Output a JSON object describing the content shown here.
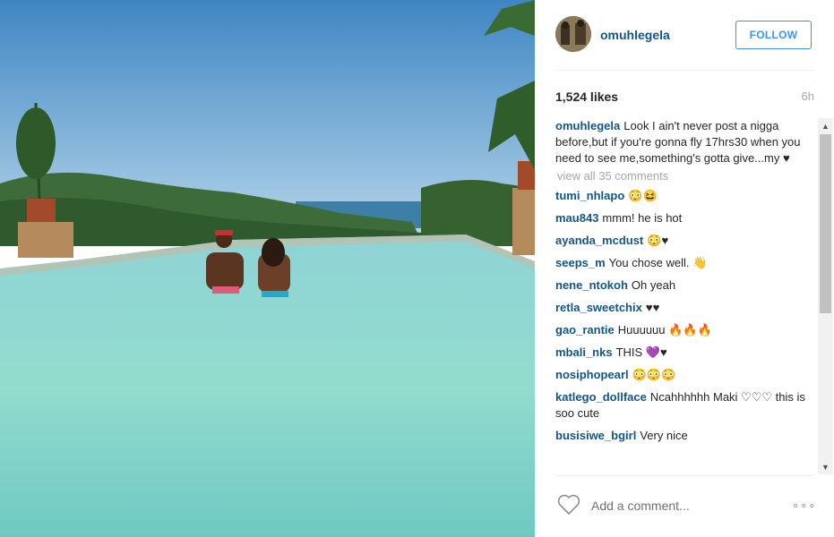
{
  "post": {
    "username": "omuhlegela",
    "follow_label": "FOLLOW",
    "likes": "1,524 likes",
    "time": "6h",
    "caption": {
      "user": "omuhlegela",
      "text": "Look I ain't never post a nigga before,but if you're gonna fly 17hrs30 when you need to see me,something's gotta give...my ♥"
    },
    "view_all": "view all 35 comments",
    "comments": [
      {
        "user": "tumi_nhlapo",
        "text": "😳😆"
      },
      {
        "user": "mau843",
        "text": "mmm! he is hot"
      },
      {
        "user": "ayanda_mcdust",
        "text": "😳♥"
      },
      {
        "user": "seeps_m",
        "text": "You chose well. 👋"
      },
      {
        "user": "nene_ntokoh",
        "text": "Oh yeah"
      },
      {
        "user": "retla_sweetchix",
        "text": "♥♥"
      },
      {
        "user": "gao_rantie",
        "text": "Huuuuuu 🔥🔥🔥"
      },
      {
        "user": "mbali_nks",
        "text": "THIS 💜♥"
      },
      {
        "user": "nosiphopearl",
        "text": "😳😳😳"
      },
      {
        "user": "katlego_dollface",
        "text": "Ncahhhhhh Maki ♡♡♡ this is soo cute"
      },
      {
        "user": "busisiwe_bgirl",
        "text": "Very nice"
      }
    ],
    "add_comment_placeholder": "Add a comment...",
    "more_label": "∘∘∘"
  },
  "icons": {
    "like": "heart-outline-icon",
    "more": "ellipsis-icon",
    "scroll_up": "arrow-up-icon",
    "scroll_down": "arrow-down-icon"
  },
  "colors": {
    "username": "#125688",
    "follow": "#3897f0",
    "muted": "#a5a7aa"
  }
}
